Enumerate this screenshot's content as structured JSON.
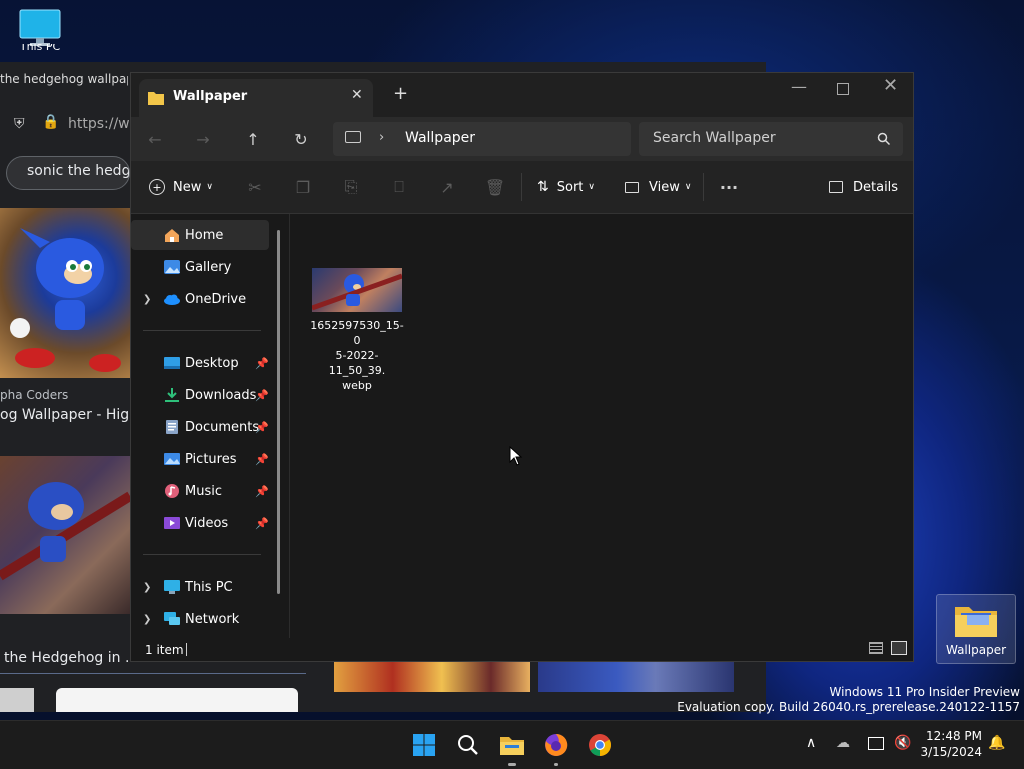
{
  "desktop": {
    "this_pc_label": "This PC",
    "wallpaper_folder_label": "Wallpaper",
    "watermark_line1": "Windows 11 Pro Insider Preview",
    "watermark_line2": "Evaluation copy. Build 26040.rs_prerelease.240122-1157"
  },
  "browser": {
    "tab_title": "the hedgehog wallpaper",
    "address_text": "https://ww",
    "search_chip": "sonic the hedgeh",
    "result1_source": "pha Coders",
    "result1_title": "og Wallpaper - High",
    "result2_title": "the Hedgehog in ..."
  },
  "explorer": {
    "tab_title": "Wallpaper",
    "breadcrumb": "Wallpaper",
    "search_placeholder": "Search Wallpaper",
    "toolbar": {
      "new_label": "New",
      "sort_label": "Sort",
      "view_label": "View",
      "more_label": "···",
      "details_label": "Details"
    },
    "nav": {
      "home": "Home",
      "gallery": "Gallery",
      "onedrive": "OneDrive",
      "desktop": "Desktop",
      "downloads": "Downloads",
      "documents": "Documents",
      "pictures": "Pictures",
      "music": "Music",
      "videos": "Videos",
      "this_pc": "This PC",
      "network": "Network"
    },
    "file": {
      "name_line1": "1652597530_15-0",
      "name_line2": "5-2022-11_50_39.",
      "name_line3": "webp"
    },
    "status": "1 item"
  },
  "taskbar": {
    "time": "12:48 PM",
    "date": "3/15/2024"
  },
  "colors": {
    "accent": "#0078d4",
    "folder_yellow": "#f3c649",
    "explorer_bg": "#191919"
  }
}
